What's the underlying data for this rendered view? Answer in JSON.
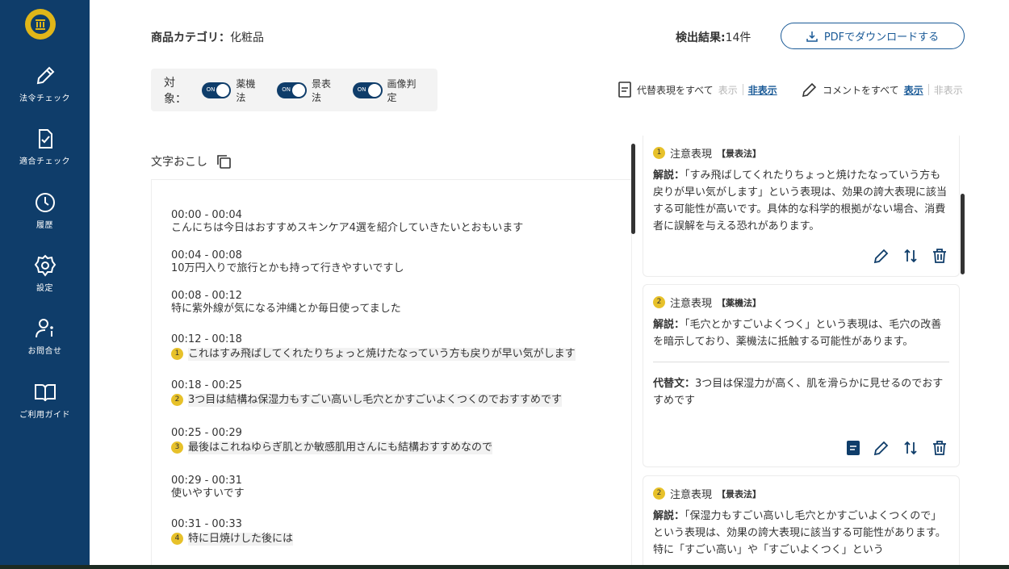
{
  "sidebar": {
    "items": [
      {
        "label": "法令チェック",
        "icon": "pencil-icon"
      },
      {
        "label": "適合チェック",
        "icon": "doc-check-icon"
      },
      {
        "label": "履歴",
        "icon": "clock-icon"
      },
      {
        "label": "設定",
        "icon": "gear-icon"
      },
      {
        "label": "お問合せ",
        "icon": "user-info-icon"
      },
      {
        "label": "ご利用ガイド",
        "icon": "book-icon"
      }
    ]
  },
  "header": {
    "category_label": "商品カテゴリ：",
    "category_value": "化粧品",
    "results_label": "検出結果:",
    "results_value": "14件",
    "pdf_button": "PDFでダウンロードする"
  },
  "filters": {
    "title": "対象：",
    "on_text": "ON",
    "items": [
      "薬機法",
      "景表法",
      "画像判定"
    ]
  },
  "controls": {
    "alt_label": "代替表現をすべて",
    "alt_show": "表示",
    "alt_hide": "非表示",
    "comment_label": "コメントをすべて",
    "comment_show": "表示",
    "comment_hide": "非表示"
  },
  "transcription": {
    "title": "文字おこし",
    "segments": [
      {
        "time": "00:00 - 00:04",
        "text": "こんにちは今日はおすすめスキンケア4選を紹介していきたいとおもいます",
        "badge": ""
      },
      {
        "time": "00:04 - 00:08",
        "text": "10万円入りで旅行とかも持って行きやすいですし",
        "badge": ""
      },
      {
        "time": "00:08 - 00:12",
        "text": "特に紫外線が気になる沖縄とか毎日使ってました",
        "badge": ""
      },
      {
        "time": "00:12 - 00:18",
        "text": "これはすみ飛ばしてくれたりちょっと焼けたなっていう方も戻りが早い気がします",
        "badge": "1"
      },
      {
        "time": "00:18 - 00:25",
        "text": "3つ目は結構ね保湿力もすごい高いし毛穴とかすごいよくつくのでおすすめです",
        "badge": "2"
      },
      {
        "time": "00:25 - 00:29",
        "text": "最後はこれねゆらぎ肌とか敏感肌用さんにも結構おすすめなので",
        "badge": "3"
      },
      {
        "time": "00:29 - 00:31",
        "text": "使いやすいです",
        "badge": ""
      },
      {
        "time": "00:31 - 00:33",
        "text": "特に日焼けした後には",
        "badge": "4"
      }
    ]
  },
  "cards": [
    {
      "badge": "1",
      "type": "注意表現",
      "law": "【景表法】",
      "explain_label": "解説：",
      "explain": "「すみ飛ばしてくれたりちょっと焼けたなっていう方も戻りが早い気がします」という表現は、効果の誇大表現に該当する可能性が高いです。具体的な科学的根拠がない場合、消費者に誤解を与える恐れがあります。"
    },
    {
      "badge": "2",
      "type": "注意表現",
      "law": "【薬機法】",
      "explain_label": "解説：",
      "explain": "「毛穴とかすごいよくつく」という表現は、毛穴の改善を暗示しており、薬機法に抵触する可能性があります。",
      "alt_label": "代替文：",
      "alt": "3つ目は保湿力が高く、肌を滑らかに見せるのでおすすめです"
    },
    {
      "badge": "2",
      "type": "注意表現",
      "law": "【景表法】",
      "explain_label": "解説：",
      "explain": "「保湿力もすごい高いし毛穴とかすごいよくつくので」という表現は、効果の誇大表現に該当する可能性があります。特に「すごい高い」や「すごいよくつく」という"
    }
  ],
  "colors": {
    "sidebar": "#0f3d6a",
    "accent": "#1a5a97",
    "badge": "#e7c12a"
  }
}
